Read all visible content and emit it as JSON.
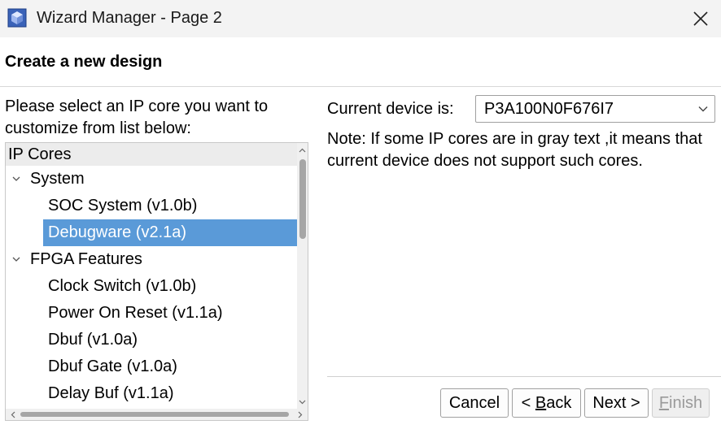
{
  "window": {
    "title": "Wizard Manager - Page 2",
    "app_icon": "wizard-cube-icon",
    "close_icon": "close-icon"
  },
  "page": {
    "heading": "Create a new design"
  },
  "left_panel": {
    "instruction": "Please select an IP core you want to customize from list below:",
    "tree": {
      "header": "IP Cores",
      "rows": [
        {
          "kind": "group",
          "label": "System",
          "expanded": true
        },
        {
          "kind": "item",
          "label": "SOC System (v1.0b)",
          "selected": false
        },
        {
          "kind": "item",
          "label": "Debugware (v2.1a)",
          "selected": true
        },
        {
          "kind": "group",
          "label": "FPGA Features",
          "expanded": true
        },
        {
          "kind": "item",
          "label": "Clock Switch (v1.0b)",
          "selected": false
        },
        {
          "kind": "item",
          "label": "Power On Reset (v1.1a)",
          "selected": false
        },
        {
          "kind": "item",
          "label": "Dbuf (v1.0a)",
          "selected": false
        },
        {
          "kind": "item",
          "label": "Dbuf Gate (v1.0a)",
          "selected": false
        },
        {
          "kind": "item",
          "label": "Delay Buf (v1.1a)",
          "selected": false
        }
      ]
    }
  },
  "right_panel": {
    "device_label": "Current device is:",
    "device_value": "P3A100N0F676I7",
    "note": "Note: If some IP cores are in gray text ,it means that current device does not support such cores."
  },
  "buttons": {
    "cancel": "Cancel",
    "back_prefix": "< ",
    "back_accel": "B",
    "back_rest": "ack",
    "next": "Next >",
    "finish_accel": "F",
    "finish_rest": "inish"
  },
  "colors": {
    "selection": "#5a9ad8",
    "titlebar": "#f3f3f3",
    "disabled_text": "#9a9a9a"
  }
}
